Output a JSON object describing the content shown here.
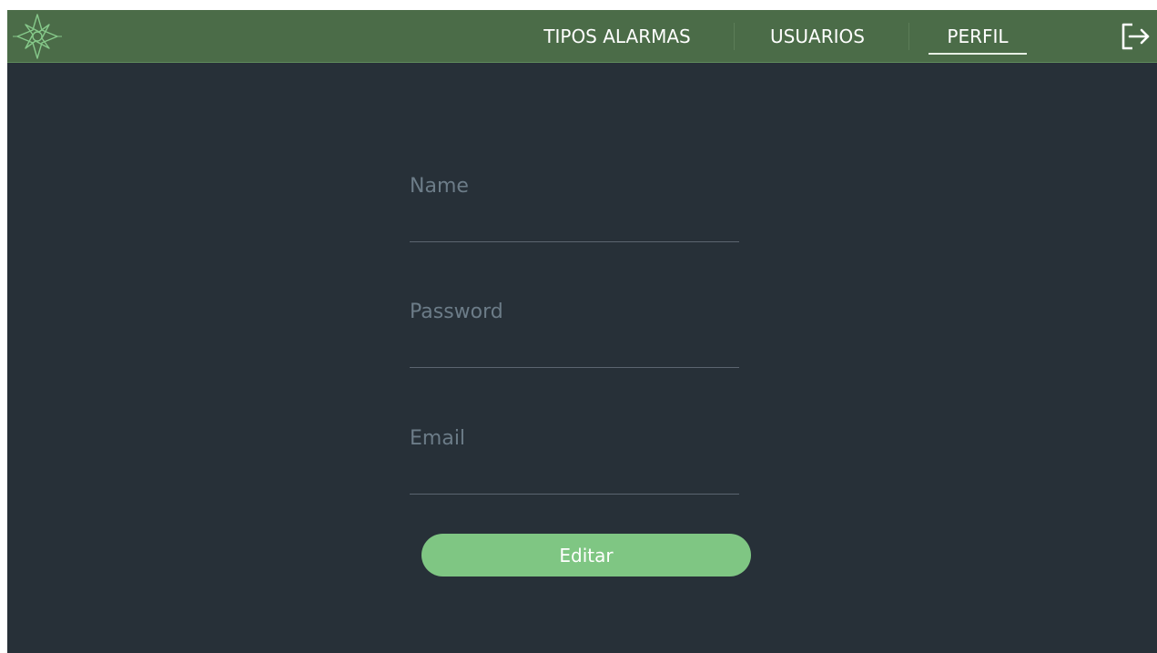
{
  "header": {
    "logo_icon": "compass-star-icon",
    "nav": [
      {
        "label": "TIPOS ALARMAS"
      },
      {
        "label": "USUARIOS"
      },
      {
        "label": "PERFIL",
        "active": true
      }
    ],
    "logout_icon": "logout-icon"
  },
  "form": {
    "name": {
      "value": "",
      "placeholder": "Name"
    },
    "password": {
      "value": "",
      "placeholder": "Password"
    },
    "email": {
      "value": "",
      "placeholder": "Email"
    },
    "submit_label": "Editar"
  },
  "colors": {
    "topbar": "#4b6c48",
    "background": "#273038",
    "accent": "#7fc683"
  }
}
